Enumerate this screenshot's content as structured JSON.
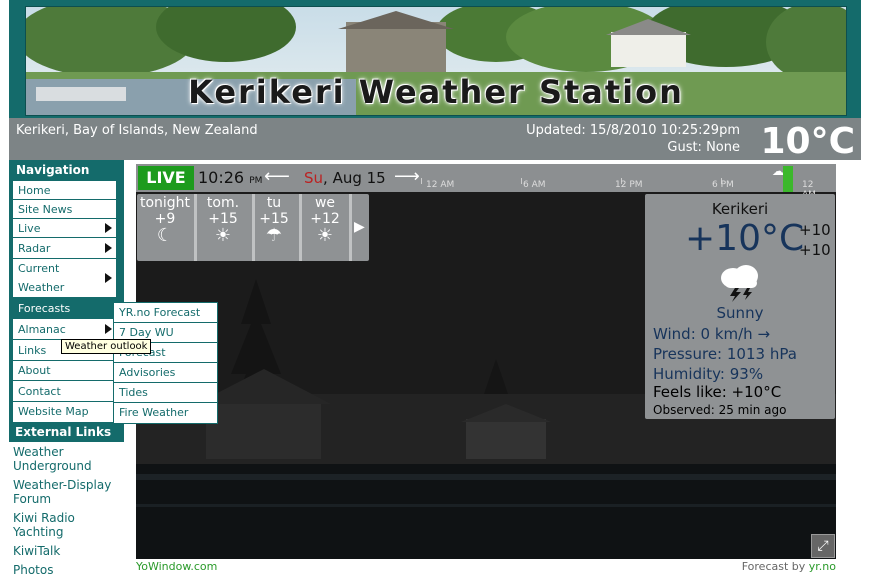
{
  "banner": {
    "title": "Kerikeri Weather Station"
  },
  "info": {
    "location": "Kerikeri, Bay of Islands, New Zealand",
    "updated": "Updated:  15/8/2010  10:25:29pm",
    "gust": "Gust: None",
    "temp": "10°C"
  },
  "nav": {
    "heading": "Navigation",
    "items": [
      "Home",
      "Site News",
      "Live",
      "Radar",
      "Current Weather",
      "Forecasts",
      "Almanac",
      "Links",
      "About",
      "Contact",
      "Website Map"
    ],
    "ext_heading": "External Links",
    "ext_items": [
      "Weather Underground",
      "Weather-Display Forum",
      "Kiwi Radio Yachting",
      "KiwiTalk",
      "Photos"
    ]
  },
  "submenu": {
    "items": [
      "YR.no Forecast",
      "7 Day WU",
      "Forecast",
      "Advisories",
      "Tides",
      "Fire Weather"
    ]
  },
  "tooltip": "Weather outlook",
  "timeline": {
    "live": "LIVE",
    "time": "10:26",
    "ampm": "PM",
    "day_name": "Su",
    "date": ", Aug 15",
    "hours": [
      "12 AM",
      "6 AM",
      "12 PM",
      "6 PM",
      "12 AM"
    ]
  },
  "forecast": [
    {
      "label": "tonight",
      "value": "+9",
      "icon": "moon-icon"
    },
    {
      "label": "tom.",
      "value": "+15",
      "icon": "sun-cloud-icon"
    },
    {
      "label": "tu",
      "value": "+15",
      "icon": "rain-icon"
    },
    {
      "label": "we",
      "value": "+12",
      "icon": "sun-cloud-icon"
    }
  ],
  "current": {
    "city": "Kerikeri",
    "temp": "+10°C",
    "hi": "+10",
    "lo": "+10",
    "condition": "Sunny",
    "wind": "Wind:  0 km/h  →",
    "pressure": "Pressure:  1013 hPa",
    "humidity": "Humidity:  93%",
    "feels": "Feels like:  +10°C",
    "observed": "Observed:  25 min ago"
  },
  "footer": {
    "left": "YoWindow.com",
    "right_prefix": "Forecast by ",
    "right_link": "yr.no"
  }
}
